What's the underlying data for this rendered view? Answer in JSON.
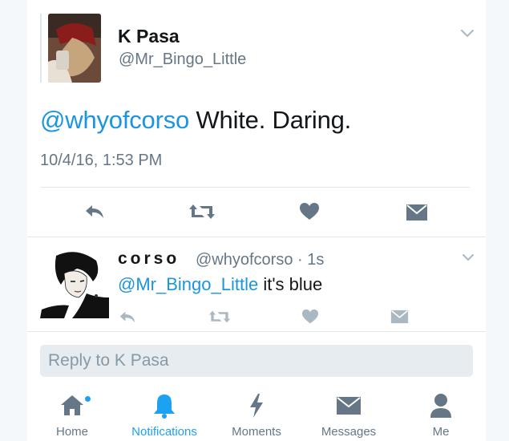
{
  "main_tweet": {
    "display_name": "K Pasa",
    "handle": "@Mr_Bingo_Little",
    "mention": "@whyofcorso",
    "text": " White. Daring.",
    "timestamp": "10/4/16, 1:53 PM",
    "actions": [
      "reply-icon",
      "retweet-icon",
      "like-icon",
      "message-icon"
    ]
  },
  "reply_tweet": {
    "display_name": "corso",
    "handle": "@whyofcorso · 1s",
    "mention": "@Mr_Bingo_Little",
    "text": " it's blue",
    "actions": [
      "reply-icon",
      "retweet-icon",
      "like-icon",
      "message-icon"
    ]
  },
  "compose": {
    "placeholder": "Reply to K Pasa"
  },
  "tab_bar": {
    "tabs": [
      {
        "label": "Home",
        "icon": "home-icon",
        "active": false,
        "badge": true
      },
      {
        "label": "Notifications",
        "icon": "bell-icon",
        "active": true,
        "badge": false
      },
      {
        "label": "Moments",
        "icon": "lightning-icon",
        "active": false,
        "badge": false
      },
      {
        "label": "Messages",
        "icon": "envelope-icon",
        "active": false,
        "badge": false
      },
      {
        "label": "Me",
        "icon": "person-icon",
        "active": false,
        "badge": false
      }
    ]
  },
  "colors": {
    "accent": "#1da1f2",
    "link": "#1b95e0",
    "muted": "#657786",
    "icon": "#657786",
    "icon_light": "#aab8c2"
  }
}
